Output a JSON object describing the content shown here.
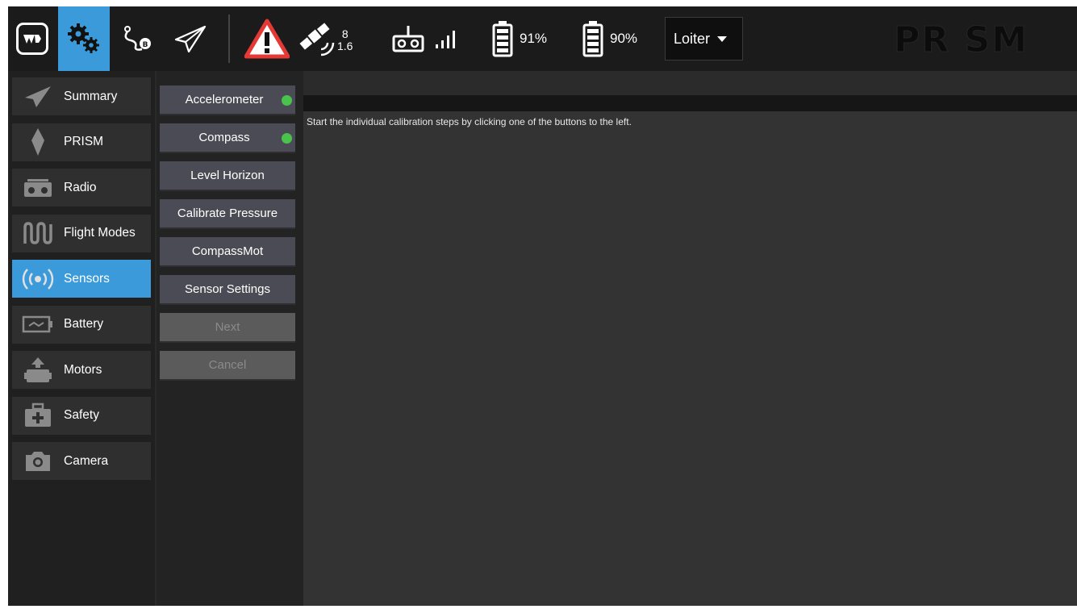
{
  "toolbar": {
    "gps": {
      "satellites": "8",
      "hdop": "1.6"
    },
    "battery1": {
      "percent": "91%"
    },
    "battery2": {
      "percent": "90%"
    },
    "flight_mode": "Loiter",
    "logo_text": "PR SM"
  },
  "nav": {
    "items": [
      {
        "label": "Summary"
      },
      {
        "label": "PRISM"
      },
      {
        "label": "Radio"
      },
      {
        "label": "Flight Modes"
      },
      {
        "label": "Sensors"
      },
      {
        "label": "Battery"
      },
      {
        "label": "Motors"
      },
      {
        "label": "Safety"
      },
      {
        "label": "Camera"
      }
    ],
    "active": "Sensors"
  },
  "sensors": {
    "buttons": [
      {
        "label": "Accelerometer",
        "status": "ok"
      },
      {
        "label": "Compass",
        "status": "ok"
      },
      {
        "label": "Level Horizon"
      },
      {
        "label": "Calibrate Pressure"
      },
      {
        "label": "CompassMot"
      },
      {
        "label": "Sensor Settings"
      },
      {
        "label": "Next",
        "enabled": false
      },
      {
        "label": "Cancel",
        "enabled": false
      }
    ],
    "status_color": "#49c34c",
    "message": "Start the individual calibration steps by clicking one of the buttons to the left."
  },
  "colors": {
    "accent": "#3b9ad9",
    "background": "#202020",
    "content": "#333333"
  }
}
